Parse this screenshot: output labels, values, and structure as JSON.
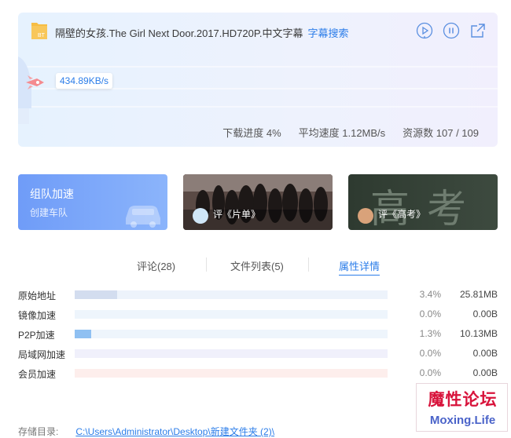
{
  "task": {
    "title": "隔壁的女孩.The Girl Next Door.2017.HD720P.中文字幕",
    "subtitle_link": "字幕搜索",
    "current_speed": "434.89KB/s",
    "progress_label": "下载进度 4%",
    "progress_percent": 4,
    "avg_speed_label": "平均速度 1.12MB/s",
    "resources_label": "资源数 107 / 109"
  },
  "icons": {
    "file": "bt-file-icon",
    "play": "play-icon",
    "pause": "pause-icon",
    "open": "open-external-icon",
    "rocket": "rocket-icon",
    "car": "car-icon"
  },
  "tiles": {
    "team": {
      "title": "组队加速",
      "link": "创建车队"
    },
    "movie": {
      "label": "评《片单》"
    },
    "gaokao": {
      "label": "评《高考》",
      "bg_text": "高考"
    }
  },
  "tabs": [
    {
      "label": "评论(28)"
    },
    {
      "label": "文件列表(5)"
    },
    {
      "label": "属性详情",
      "active": true
    }
  ],
  "speed_rows": [
    {
      "label": "原始地址",
      "percent_text": "3.4%",
      "size": "25.81MB",
      "fraction": 0.034,
      "color": "#d3ddef",
      "track": "#edf3fb"
    },
    {
      "label": "镜像加速",
      "percent_text": "0.0%",
      "size": "0.00B",
      "fraction": 0.0,
      "color": "#cfe3fb",
      "track": "#eef5fc"
    },
    {
      "label": "P2P加速",
      "percent_text": "1.3%",
      "size": "10.13MB",
      "fraction": 0.013,
      "color": "#8fc0f2",
      "track": "#eef5fc"
    },
    {
      "label": "局域网加速",
      "percent_text": "0.0%",
      "size": "0.00B",
      "fraction": 0.0,
      "color": "#e3e4f6",
      "track": "#f0f0fb"
    },
    {
      "label": "会员加速",
      "percent_text": "0.0%",
      "size": "0.00B",
      "fraction": 0.0,
      "color": "#fbe2df",
      "track": "#fdeeec"
    }
  ],
  "path": {
    "label": "存储目录:",
    "value": "C:\\Users\\Administrator\\Desktop\\新建文件夹 (2)\\"
  },
  "watermark": {
    "line1": "魔性论坛",
    "line2": "Moxing.Life"
  },
  "colors": {
    "accent": "#2b7de9",
    "card_bg": "#e9f2fd",
    "bt_icon": "#f5b93c"
  }
}
